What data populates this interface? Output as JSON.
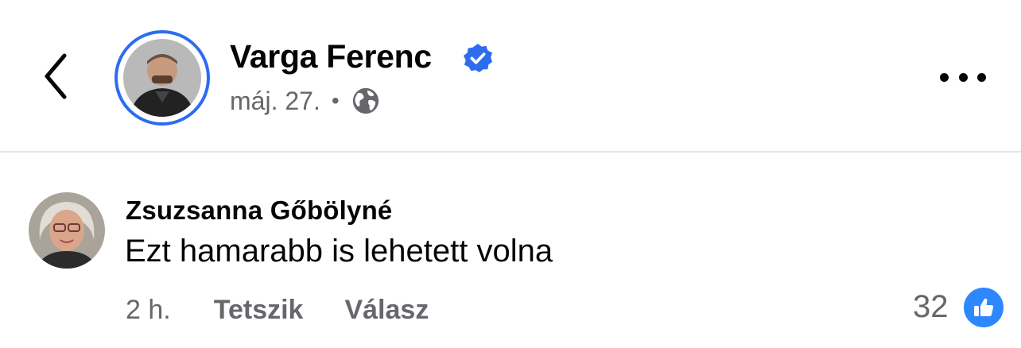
{
  "post": {
    "author": "Varga Ferenc",
    "date": "máj. 27.",
    "separator": "•",
    "verified": true,
    "audience_icon": "globe-icon"
  },
  "header": {
    "back_icon": "chevron-left-icon",
    "more_icon": "more-dots-icon"
  },
  "comment": {
    "author": "Zsuzsanna Gőbölyné",
    "text": "Ezt hamarabb is lehetett volna",
    "time": "2 h.",
    "like_label": "Tetszik",
    "reply_label": "Válasz",
    "reaction_count": "32",
    "reaction_icon": "thumbs-up-icon"
  },
  "colors": {
    "accent": "#2d6cf0",
    "secondary_text": "#65676b",
    "reaction_blue": "#2d88ff"
  }
}
